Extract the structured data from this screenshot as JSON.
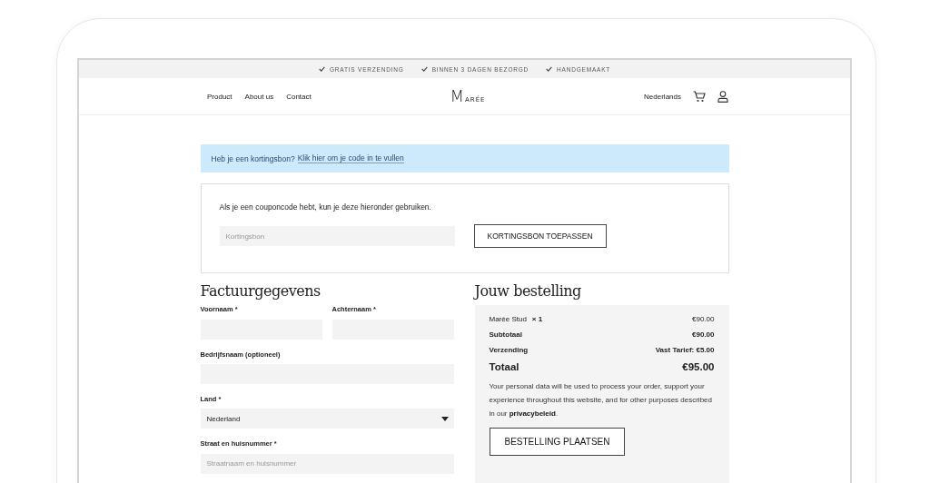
{
  "topbar": {
    "items": [
      "GRATIS VERZENDING",
      "BINNEN 3 DAGEN BEZORGD",
      "HANDGEMAAKT"
    ]
  },
  "nav": {
    "links": [
      "Product",
      "About us",
      "Contact"
    ],
    "logo_initial": "M",
    "logo_rest": "ARÉE",
    "language": "Nederlands"
  },
  "notice": {
    "text": "Heb je een kortingsbon?",
    "link": "Klik hier om je code in te vullen"
  },
  "coupon": {
    "text": "Als je een couponcode hebt, kun je deze hieronder gebruiken.",
    "placeholder": "Kortingsbon",
    "button": "KORTINGSBON TOEPASSEN"
  },
  "billing": {
    "title": "Factuurgegevens",
    "fields": [
      {
        "label": "Voornaam *",
        "kind": "text",
        "half": true
      },
      {
        "label": "Achternaam *",
        "kind": "text",
        "half": true
      },
      {
        "label": "Bedrijfsnaam (optioneel)",
        "kind": "text",
        "half": false
      },
      {
        "label": "Land *",
        "kind": "select",
        "half": false,
        "value": "Nederland"
      },
      {
        "label": "Straat en huisnummer *",
        "kind": "text",
        "half": false,
        "placeholder": "Straatnaam en huisnummer"
      }
    ]
  },
  "order": {
    "title": "Jouw bestelling",
    "product": {
      "name": "Marée Stud",
      "qty": "× 1",
      "price": "€90.00"
    },
    "rows": [
      {
        "label": "Subtotaal",
        "value": "€90.00",
        "kind": "sub"
      },
      {
        "label": "Verzending",
        "value": "Vast Tarief: €5.00",
        "kind": "sub"
      },
      {
        "label": "Totaal",
        "value": "€95.00",
        "kind": "total"
      }
    ],
    "privacy_text": "Your personal data will be used to process your order, support your experience throughout this website, and for other purposes described in our",
    "privacy_link": "privacybeleid",
    "privacy_end": ".",
    "button": "BESTELLING PLAATSEN"
  }
}
